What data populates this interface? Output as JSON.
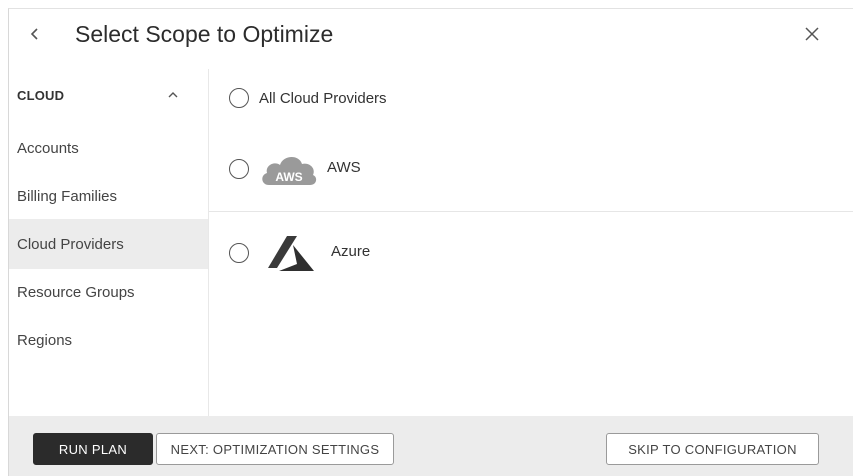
{
  "header": {
    "title": "Select Scope to Optimize",
    "back_icon": "chevron-left-icon",
    "close_icon": "close-icon"
  },
  "sidebar": {
    "section_label": "CLOUD",
    "section_icon": "chevron-up-icon",
    "items": [
      {
        "label": "Accounts",
        "active": false
      },
      {
        "label": "Billing Families",
        "active": false
      },
      {
        "label": "Cloud Providers",
        "active": true
      },
      {
        "label": "Resource Groups",
        "active": false
      },
      {
        "label": "Regions",
        "active": false
      }
    ]
  },
  "main": {
    "options": [
      {
        "label": "All Cloud Providers",
        "selected": false
      },
      {
        "label": "AWS",
        "logo_text": "AWS",
        "logo_icon": "aws-cloud-icon",
        "selected": false
      },
      {
        "label": "Azure",
        "logo_icon": "azure-logo-icon",
        "selected": false
      }
    ]
  },
  "footer": {
    "run_plan_label": "RUN PLAN",
    "next_label": "NEXT: OPTIMIZATION SETTINGS",
    "skip_label": "SKIP TO CONFIGURATION"
  },
  "colors": {
    "primary_button": "#2b2b2b",
    "active_item_bg": "#ececec",
    "footer_bg": "#ececec",
    "logo_gray": "#9a9a9a",
    "azure_logo": "#3a3a3a"
  }
}
